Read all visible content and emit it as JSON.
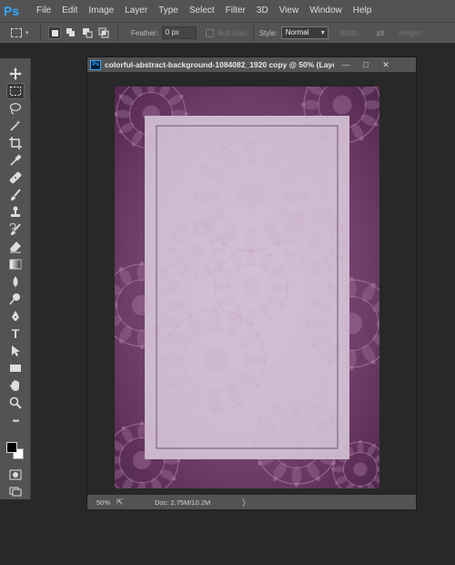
{
  "app": {
    "logo": "Ps",
    "accent": "#31a8ff"
  },
  "menu": [
    "File",
    "Edit",
    "Image",
    "Layer",
    "Type",
    "Select",
    "Filter",
    "3D",
    "View",
    "Window",
    "Help"
  ],
  "options": {
    "feather_label": "Feather:",
    "feather_value": "0 px",
    "antialias_label": "Anti-alias",
    "style_label": "Style:",
    "style_value": "Normal",
    "width_label": "Width:",
    "height_label": "Height:"
  },
  "toolbox": {
    "tools": [
      "move-tool",
      "marquee-tool",
      "lasso-tool",
      "magic-wand-tool",
      "crop-tool",
      "eyedropper-tool",
      "healing-tool",
      "brush-tool",
      "stamp-tool",
      "history-brush-tool",
      "eraser-tool",
      "gradient-tool",
      "blur-tool",
      "dodge-tool",
      "pen-tool",
      "type-tool",
      "path-select-tool",
      "rectangle-tool",
      "hand-tool",
      "zoom-tool",
      "more-tools"
    ],
    "active_tool": "marquee-tool",
    "foreground_color": "#000000",
    "background_color": "#ffffff",
    "type_glyph": "T",
    "more_glyph": "•••"
  },
  "document": {
    "title": "colorful-abstract-background-1084082_1920 copy @ 50% (Layer 1, ...",
    "ps_badge": "Ps",
    "minimize": "—",
    "maximize": "□",
    "close": "✕",
    "image_colors": {
      "dark": "#5a2d57",
      "mid": "#7a4a76",
      "overlay": "#e8dcea"
    }
  },
  "status": {
    "zoom": "50%",
    "doc_size": "Doc: 2.75M/10.2M",
    "arrow": "〉"
  }
}
